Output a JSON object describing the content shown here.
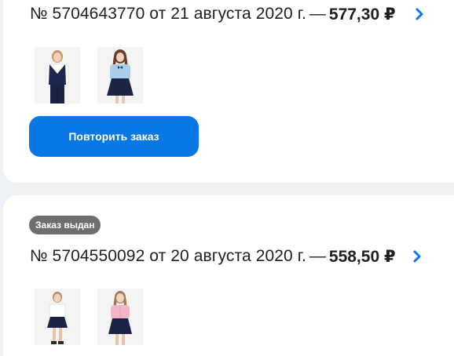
{
  "colors": {
    "accent": "#0a77e6",
    "badge_bg": "#6e6e6e",
    "page_bg": "#eef1f6",
    "card_bg": "#ffffff",
    "text": "#1f1f1f"
  },
  "orders": [
    {
      "title": "№ 5704643770 от 21 августа 2020 г.",
      "separator": "—",
      "sum": "577,30 ₽",
      "chevron_icon": "chevron-right-icon",
      "thumbnails": [
        "school-vest-uniform-photo",
        "blue-blouse-skirt-photo"
      ],
      "repeat_button_label": "Повторить заказ"
    },
    {
      "status": "Заказ выдан",
      "title": "№ 5704550092 от 20 августа 2020 г.",
      "separator": "—",
      "sum": "558,50 ₽",
      "chevron_icon": "chevron-right-icon",
      "thumbnails": [
        "white-blouse-skirt-photo",
        "pink-blouse-skirt-photo"
      ]
    }
  ]
}
